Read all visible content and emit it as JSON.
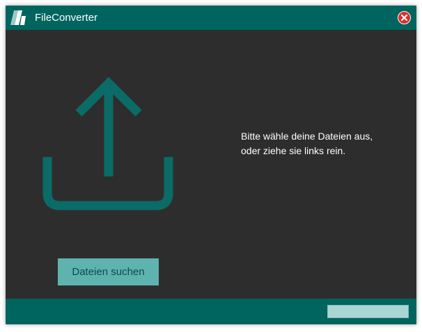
{
  "window": {
    "title": "FileConverter",
    "logo_icon": "file-converter-logo-icon",
    "close_icon": "close-circle-icon"
  },
  "main": {
    "upload_icon": "upload-tray-icon",
    "message_line1": "Bitte wähle deine Dateien aus,",
    "message_line2": "oder ziehe sie links rein.",
    "browse_button_label": "Dateien suchen"
  },
  "statusbar": {
    "progress": 0
  },
  "colors": {
    "titlebar": "#00655f",
    "background": "#2d2d2d",
    "accent": "#0b6b66",
    "button": "#5eb3ae",
    "close": "#d9302b"
  }
}
